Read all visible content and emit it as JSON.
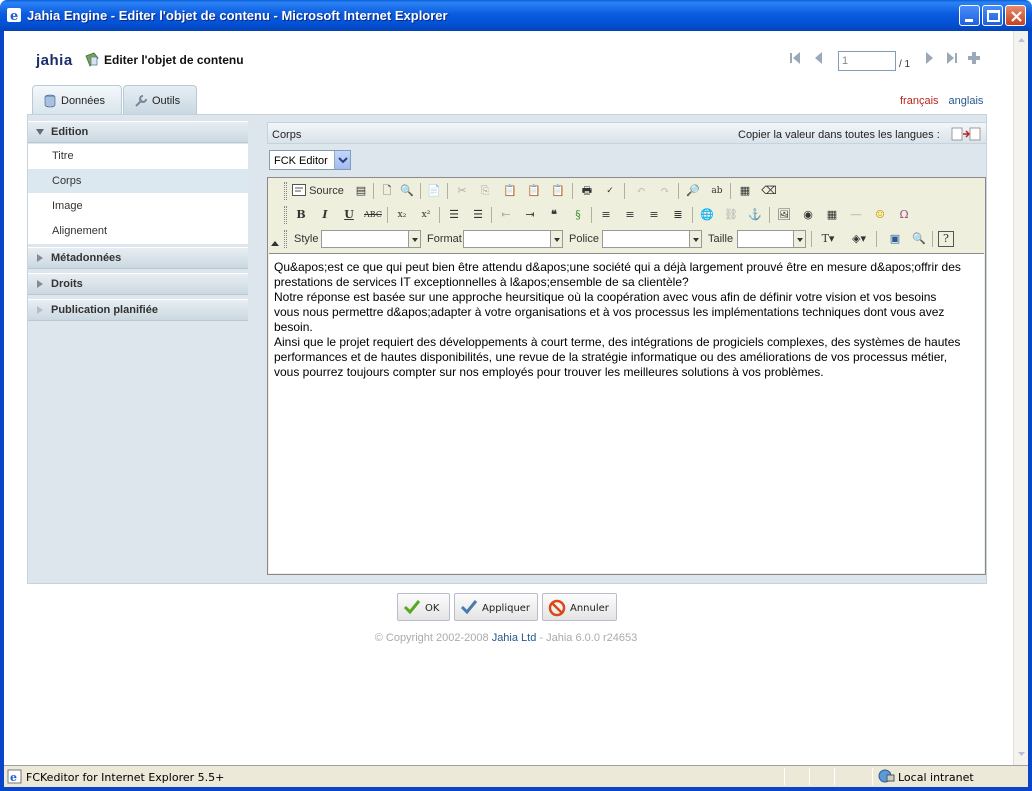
{
  "window": {
    "title": "Jahia Engine - Editer l'objet de contenu - Microsoft Internet Explorer"
  },
  "header": {
    "logo_text": "jahia",
    "page_title": "Editer l'objet de contenu"
  },
  "pager": {
    "current": "1",
    "total_label": "/ 1"
  },
  "languages": {
    "fr": "français",
    "en": "anglais"
  },
  "tabs": [
    {
      "label": "Données",
      "active": true
    },
    {
      "label": "Outils",
      "active": false
    }
  ],
  "sidebar": {
    "sections": [
      {
        "label": "Edition",
        "expanded": true,
        "items": [
          "Titre",
          "Corps",
          "Image",
          "Alignement"
        ],
        "selected": "Corps"
      },
      {
        "label": "Métadonnées",
        "expanded": false
      },
      {
        "label": "Droits",
        "expanded": false
      },
      {
        "label": "Publication planifiée",
        "expanded": false
      }
    ]
  },
  "field": {
    "label": "Corps",
    "copy_label": "Copier la valeur dans toutes les langues :",
    "editor_select": "FCK Editor"
  },
  "toolbar": {
    "source_label": "Source",
    "style_label": "Style",
    "format_label": "Format",
    "police_label": "Police",
    "taille_label": "Taille"
  },
  "editor_text": "Qu&apos;est ce que qui peut bien être attendu d&apos;une société qui a déjà largement prouvé être en mesure d&apos;offrir des prestations de services IT exceptionnelles à l&apos;ensemble de sa clientèle?\nNotre réponse est basée sur une approche heursitique où la coopération avec vous afin de définir votre vision et vos besoins vous nous permettre d&apos;adapter à votre organisations et à vos processus les implémentations techniques dont vous avez besoin.\nAinsi que le projet requiert des développements à court terme, des intégrations de progiciels complexes, des systèmes de hautes performances et de hautes disponibilités, une revue de la stratégie informatique ou des améliorations de vos processus métier, vous pourrez toujours compter sur nos employés pour trouver les meilleures solutions à vos problèmes.",
  "buttons": {
    "ok": "OK",
    "apply": "Appliquer",
    "cancel": "Annuler"
  },
  "footer": {
    "copyright_prefix": "© Copyright 2002-2008",
    "company": "Jahia Ltd",
    "version": "- Jahia 6.0.0 r24653"
  },
  "statusbar": {
    "text": "FCKeditor for Internet Explorer 5.5+",
    "zone": "Local intranet"
  },
  "colors": {
    "titlebar": "#0350d4",
    "panel": "#dde6ec",
    "lang_active": "#b8261c",
    "link": "#245a8c"
  }
}
